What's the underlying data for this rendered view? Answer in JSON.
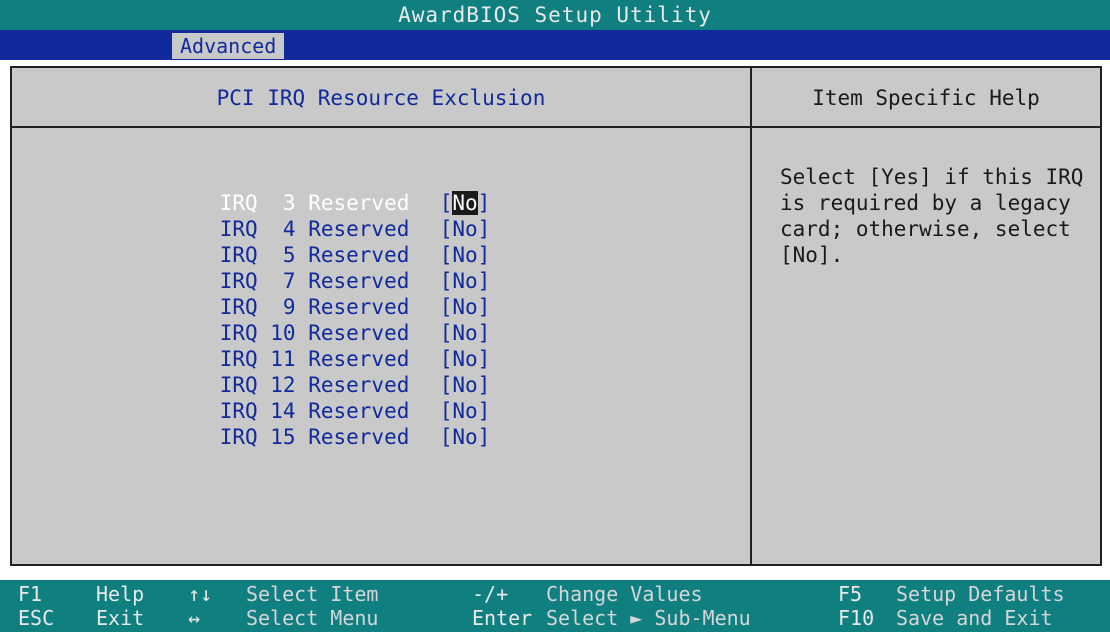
{
  "window": {
    "title": "AwardBIOS Setup Utility"
  },
  "menubar": {
    "active_tab": "Advanced"
  },
  "left_panel": {
    "title": "PCI IRQ Resource Exclusion",
    "items": [
      {
        "label": "IRQ  3 Reserved",
        "value": "No",
        "selected": true
      },
      {
        "label": "IRQ  4 Reserved",
        "value": "No"
      },
      {
        "label": "IRQ  5 Reserved",
        "value": "No"
      },
      {
        "label": "IRQ  7 Reserved",
        "value": "No"
      },
      {
        "label": "IRQ  9 Reserved",
        "value": "No"
      },
      {
        "label": "IRQ 10 Reserved",
        "value": "No"
      },
      {
        "label": "IRQ 11 Reserved",
        "value": "No"
      },
      {
        "label": "IRQ 12 Reserved",
        "value": "No"
      },
      {
        "label": "IRQ 14 Reserved",
        "value": "No"
      },
      {
        "label": "IRQ 15 Reserved",
        "value": "No"
      }
    ]
  },
  "right_panel": {
    "title": "Item Specific Help",
    "help_text": "Select [Yes] if this IRQ\nis required by a legacy\ncard; otherwise, select\n[No]."
  },
  "footer": {
    "row1": [
      {
        "key": "F1",
        "desc": "Help"
      },
      {
        "key": "↑↓",
        "desc": "Select Item"
      },
      {
        "key": "-/+",
        "desc": "Change Values"
      },
      {
        "key": "F5",
        "desc": "Setup Defaults"
      }
    ],
    "row2": [
      {
        "key": "ESC",
        "desc": "Exit"
      },
      {
        "key": "↔",
        "desc": "Select Menu"
      },
      {
        "key": "Enter",
        "desc": "Select ► Sub-Menu"
      },
      {
        "key": "F10",
        "desc": "Save and Exit"
      }
    ]
  },
  "colors": {
    "title_bar": "#0f7f80",
    "menu_bar": "#102a9c",
    "panel_bg": "#c9c9c9",
    "text_blue": "#102a9c"
  }
}
